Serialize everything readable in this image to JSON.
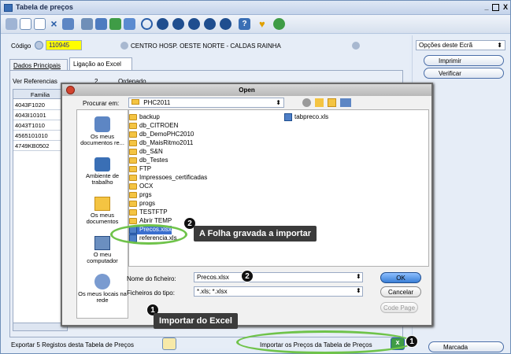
{
  "window": {
    "title": "Tabela de preços",
    "controls": [
      "_",
      "□",
      "X"
    ]
  },
  "form": {
    "codigo_label": "Código",
    "codigo_value": "110945",
    "client_name": "CENTRO HOSP. OESTE NORTE - CALDAS RAINHA",
    "tabs": [
      "Dados Principais",
      "Ligação ao Excel"
    ],
    "ver_referencias_label": "Ver Referencias",
    "ver_value": "2",
    "ver_extra": "Ordenado",
    "grid_header": "Familia",
    "grid_rows": [
      "4043F1020",
      "4043I10101",
      "4043T1010",
      "4565101010",
      "4749KB0502"
    ]
  },
  "right_panel": {
    "options_label": "Opções deste Ecrã",
    "print_label": "Imprimir",
    "check_label": "Verificar",
    "marked_label": "Marcada"
  },
  "bottom": {
    "export_label": "Exportar 5 Registos desta Tabela de Preços",
    "import_label": "Importar os Preços da Tabela de Preços"
  },
  "dialog": {
    "title": "Open",
    "look_in_label": "Procurar em:",
    "look_in_value": "PHC2011",
    "places": [
      {
        "label": "Os meus documentos re...",
        "icon": "recent-documents-icon"
      },
      {
        "label": "Ambiente de trabalho",
        "icon": "desktop-icon"
      },
      {
        "label": "Os meus documentos",
        "icon": "my-documents-icon"
      },
      {
        "label": "O meu computador",
        "icon": "my-computer-icon"
      },
      {
        "label": "Os meus locais na rede",
        "icon": "network-places-icon"
      }
    ],
    "files": [
      "backup",
      "db_CITROEN",
      "db_DemoPHC2010",
      "db_MaisRitmo2011",
      "db_S&N",
      "db_Testes",
      "FTP",
      "Impressoes_certificadas",
      "OCX",
      "prgs",
      "progs",
      "TESTFTP",
      "Abrir TEMP",
      "Precos.xlsx",
      "referencia.xls"
    ],
    "file_types": [
      "folder",
      "folder",
      "folder",
      "folder",
      "folder",
      "folder",
      "folder",
      "folder",
      "folder",
      "folder",
      "folder",
      "folder",
      "folder",
      "xls",
      "xls"
    ],
    "right_file": "tabpreco.xls",
    "filename_label": "Nome do ficheiro:",
    "filename_value": "Precos.xlsx",
    "filetype_label": "Ficheiros do tipo:",
    "filetype_value": "*.xls; *.xlsx",
    "ok_label": "OK",
    "cancel_label": "Cancelar",
    "codepage_label": "Code Page"
  },
  "annotations": {
    "callout_sheet": "A Folha gravada a importar",
    "callout_import": "Importar do Excel",
    "step1": "1",
    "step2": "2"
  },
  "colors": {
    "accent": "#1f4e8f",
    "callout_bg": "#3b3b3b",
    "highlight_ring": "#6fc34a",
    "code_field": "#ffff00"
  }
}
